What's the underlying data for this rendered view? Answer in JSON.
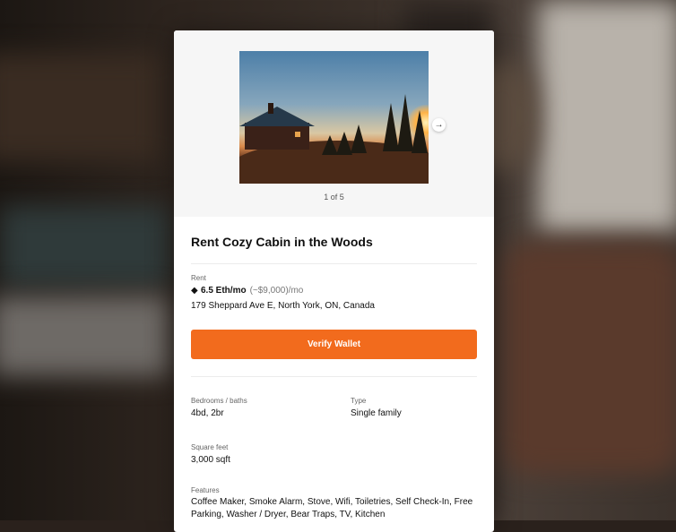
{
  "gallery": {
    "counter": "1 of 5",
    "next_icon": "arrow-right-icon"
  },
  "listing": {
    "title": "Rent Cozy Cabin in the Woods",
    "rent_label": "Rent",
    "rent_eth": "6.5 Eth/mo",
    "rent_usd": "(~$9,000)/mo",
    "address": "179 Sheppard Ave E, North York, ON, Canada",
    "cta_label": "Verify Wallet",
    "bed_bath_label": "Bedrooms / baths",
    "bed_bath_value": "4bd, 2br",
    "type_label": "Type",
    "type_value": "Single family",
    "sqft_label": "Square feet",
    "sqft_value": "3,000 sqft",
    "features_label": "Features",
    "features_value": "Coffee Maker, Smoke Alarm, Stove, Wifi, Toiletries, Self Check-In, Free Parking, Washer / Dryer, Bear Traps, TV, Kitchen"
  },
  "colors": {
    "accent": "#f26b1d",
    "card_bg": "#ffffff",
    "gallery_bg": "#f6f6f6"
  }
}
